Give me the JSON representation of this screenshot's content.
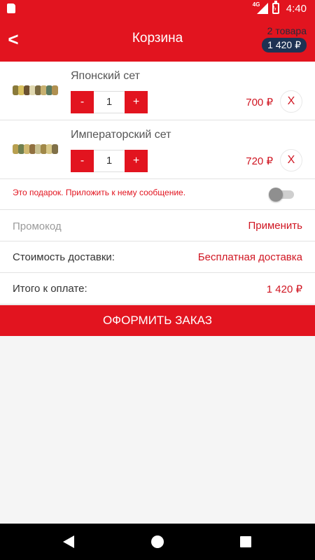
{
  "status": {
    "network": "4G",
    "time": "4:40"
  },
  "header": {
    "title": "Корзина",
    "item_count": "2 товара",
    "total": "1 420 ₽"
  },
  "items": [
    {
      "name": "Японский сет",
      "qty": "1",
      "minus": "-",
      "plus": "+",
      "price": "700 ₽",
      "remove": "X"
    },
    {
      "name": "Императорский сет",
      "qty": "1",
      "minus": "-",
      "plus": "+",
      "price": "720 ₽",
      "remove": "X"
    }
  ],
  "gift": {
    "text": "Это подарок. Приложить к нему сообщение.",
    "enabled": false
  },
  "promo": {
    "placeholder": "Промокод",
    "apply_label": "Применить"
  },
  "delivery": {
    "label": "Стоимость доставки:",
    "value": "Бесплатная доставка"
  },
  "total": {
    "label": "Итого к оплате:",
    "value": "1 420 ₽"
  },
  "checkout_label": "ОФОРМИТЬ ЗАКАЗ",
  "colors": {
    "accent": "#e2141f",
    "price": "#d01622",
    "badge": "#1e3253"
  }
}
